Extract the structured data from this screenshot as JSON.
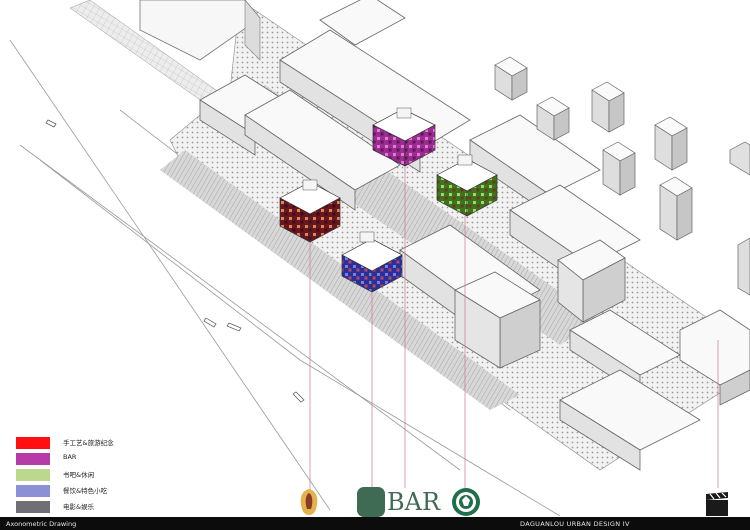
{
  "legend": {
    "items": [
      {
        "label": "手工艺&旅游纪念",
        "color": "#ff0f0f"
      },
      {
        "label": "BAR",
        "color": "#b63aa8"
      },
      {
        "label": "书吧&休闲",
        "color": "#bcd88f"
      },
      {
        "label": "餐饮&特色小吃",
        "color": "#8c90d4"
      },
      {
        "label": "电影&娱乐",
        "color": "#6f6f75"
      }
    ]
  },
  "logos": {
    "bar_text": "BAR",
    "coffee_name": "starbucks-logo",
    "craft_name": "craft-figure-logo",
    "film_name": "clapperboard-icon"
  },
  "footer": {
    "left": "Axonometric Drawing",
    "right": "DAGUANLOU  URBAN DESIGN  IV"
  },
  "colors": {
    "red_block": "#8a1f2a",
    "magenta_block": "#b63aa8",
    "green_block": "#4e8a2a",
    "blue_block": "#3d3fa6",
    "line": "#555555",
    "hatch": "#9a9a9a"
  }
}
